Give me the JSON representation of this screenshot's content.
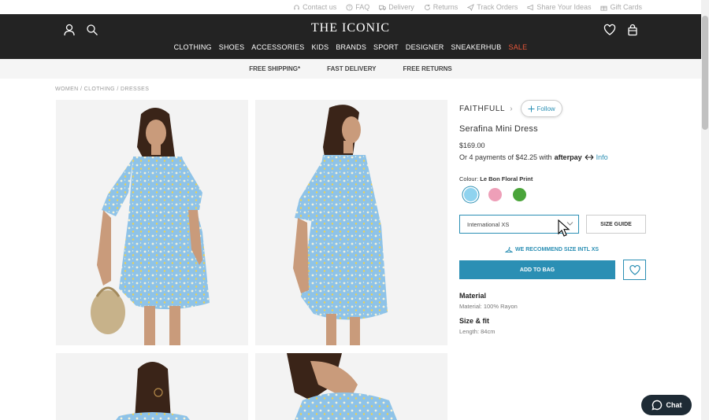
{
  "utility": {
    "links": [
      {
        "label": "Contact us",
        "icon": "headset-icon"
      },
      {
        "label": "FAQ",
        "icon": "question-icon"
      },
      {
        "label": "Delivery",
        "icon": "truck-icon"
      },
      {
        "label": "Returns",
        "icon": "returns-icon"
      },
      {
        "label": "Track Orders",
        "icon": "arrow-icon"
      },
      {
        "label": "Share Your Ideas",
        "icon": "megaphone-icon"
      },
      {
        "label": "Gift Cards",
        "icon": "gift-icon"
      }
    ]
  },
  "header": {
    "logo": "THE ICONIC",
    "nav": [
      "CLOTHING",
      "SHOES",
      "ACCESSORIES",
      "KIDS",
      "BRANDS",
      "SPORT",
      "DESIGNER",
      "SNEAKERHUB",
      "SALE"
    ]
  },
  "promo": {
    "items": [
      "FREE SHIPPING*",
      "FAST DELIVERY",
      "FREE RETURNS"
    ]
  },
  "breadcrumb": "WOMEN / CLOTHING / DRESSES",
  "product": {
    "brand": "FAITHFULL",
    "chevron": "›",
    "follow_label": "Follow",
    "name": "Serafina Mini Dress",
    "price": "$169.00",
    "afterpay_prefix": "Or 4 payments of $42.25 with",
    "afterpay_logo": "afterpay",
    "afterpay_info": "Info",
    "colour_label": "Colour:",
    "colour_value": "Le Bon Floral Print",
    "swatches": [
      {
        "color": "#8fd3ef",
        "selected": true
      },
      {
        "color": "#ee9fb8",
        "selected": false
      },
      {
        "color": "#4aa43a",
        "selected": false
      }
    ],
    "size_selected": "International XS",
    "size_guide": "SIZE GUIDE",
    "recommend": "WE RECOMMEND SIZE INTL XS",
    "add_to_bag": "ADD TO BAG",
    "material_head": "Material",
    "material_text": "Material: 100% Rayon",
    "fit_head": "Size & fit",
    "fit_text": "Length: 84cm"
  },
  "chat": {
    "label": "Chat"
  },
  "colors": {
    "accent": "#2b8fb4",
    "header_bg": "#232323",
    "sale": "#e8573a",
    "dress": "#8ec3e8"
  }
}
